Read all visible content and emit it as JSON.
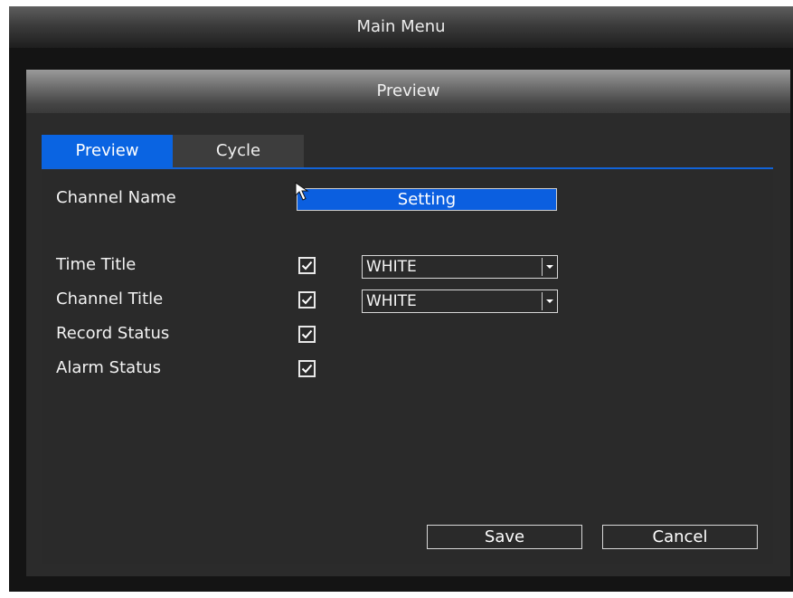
{
  "main_menu": {
    "title": "Main Menu"
  },
  "dialog": {
    "title": "Preview"
  },
  "tabs": [
    {
      "label": "Preview",
      "active": true
    },
    {
      "label": "Cycle",
      "active": false
    }
  ],
  "form": {
    "channel_name": {
      "label": "Channel Name",
      "button_label": "Setting"
    },
    "time_title": {
      "label": "Time Title",
      "checked": true,
      "color_value": "WHITE"
    },
    "channel_title": {
      "label": "Channel Title",
      "checked": true,
      "color_value": "WHITE"
    },
    "record_status": {
      "label": "Record Status",
      "checked": true
    },
    "alarm_status": {
      "label": "Alarm Status",
      "checked": true
    }
  },
  "actions": {
    "save_label": "Save",
    "cancel_label": "Cancel"
  },
  "colors": {
    "accent": "#0a64e2",
    "panel_bg": "#2a2a2a",
    "title_bar": "#5e5e5e"
  },
  "icons": {
    "cursor": "mouse-pointer-icon",
    "checkbox": "checkmark-icon",
    "dropdown": "chevron-down-icon"
  }
}
